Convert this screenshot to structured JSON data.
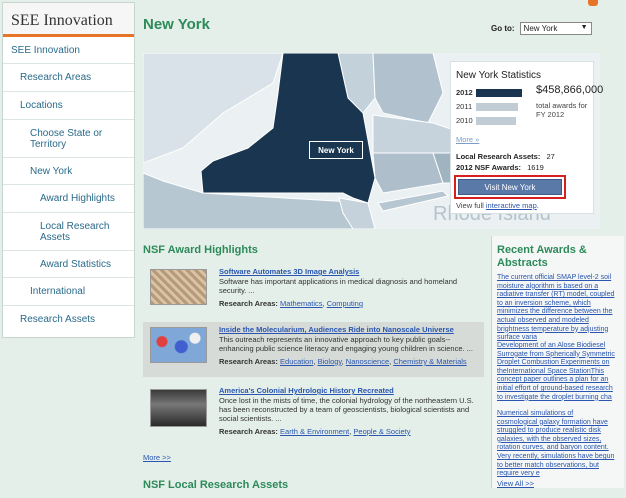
{
  "sidebar": {
    "brand": "SEE Innovation",
    "items": [
      {
        "label": "SEE Innovation"
      },
      {
        "label": "Research Areas"
      },
      {
        "label": "Locations"
      },
      {
        "label": "Choose State or Territory"
      },
      {
        "label": "New York"
      },
      {
        "label": "Award Highlights"
      },
      {
        "label": "Local Research Assets"
      },
      {
        "label": "Award Statistics"
      },
      {
        "label": "International"
      },
      {
        "label": "Research Assets"
      }
    ]
  },
  "header": {
    "title": "New York",
    "goto_label": "Go to:",
    "goto_value": "New York"
  },
  "map": {
    "selected_label": "New York",
    "neighbor_label": "Rhode Island"
  },
  "stats": {
    "title": "New York Statistics",
    "bars": [
      {
        "year": "2012",
        "value_fraction": 1.0,
        "current": true
      },
      {
        "year": "2011",
        "value_fraction": 0.92,
        "current": false
      },
      {
        "year": "2010",
        "value_fraction": 0.86,
        "current": false
      }
    ],
    "amount": "$458,866,000",
    "amount_desc_1": "total awards for",
    "amount_desc_2": "FY 2012",
    "more_link": "More »",
    "local_assets_label": "Local Research Assets:",
    "local_assets_value": "27",
    "nsf_awards_label": "2012 NSF Awards:",
    "nsf_awards_value": "1619",
    "visit_button": "Visit New York",
    "view_full_prefix": "View full",
    "view_full_link": "interactive map",
    "view_full_suffix": "."
  },
  "highlights": {
    "title": "NSF Award Highlights",
    "areas_label": "Research Areas:",
    "items": [
      {
        "title": "Software Automates 3D Image Analysis",
        "body": "Software has important applications in medical diagnosis and homeland security. ...",
        "areas": [
          "Mathematics",
          "Computing"
        ]
      },
      {
        "title": "Inside the Molecularium, Audiences Ride into Nanoscale Universe",
        "body": "This outreach represents an innovative approach to key public goals--enhancing public science literacy and engaging young children in science. ...",
        "areas": [
          "Education",
          "Biology",
          "Nanoscience",
          "Chemistry & Materials"
        ]
      },
      {
        "title": "America's Colonial Hydrologic History Recreated",
        "body": "Once lost in the mists of time, the colonial hydrology of the northeastern U.S. has been reconstructed by a team of geoscientists, biological scientists and social scientists. ...",
        "areas": [
          "Earth & Environment",
          "People & Society"
        ]
      }
    ],
    "more": "More >>"
  },
  "local_assets": {
    "title": "NSF Local Research Assets"
  },
  "recent": {
    "title": "Recent Awards & Abstracts",
    "items": [
      "The current official SMAP level-2 soil moisture algorithm is based on a radiative transfer (RT) model, coupled to an inversion scheme, which minimizes the difference between the actual observed and modeled brightness temperature by adjusting surface varia",
      "Development of an Alose Biodiesel Surrogate from Spherically Symmetric Droplet Combustion Experiments on theInternational Space StationThis concept paper outlines a plan for an initial effort of ground-based research to investigate the droplet burning cha",
      "Numerical simulations of cosmological galaxy formation have struggled to produce realistic disk galaxies, with the observed sizes, rotation curves, and baryon content. Very recently, simulations have begun to better match observations, but require very e"
    ],
    "view_all": "View All >>"
  },
  "colors": {
    "accent_green": "#2d8a5a",
    "brand_orange": "#e8742a",
    "selected_state": "#1a3550",
    "highlight_border": "#d42020"
  }
}
